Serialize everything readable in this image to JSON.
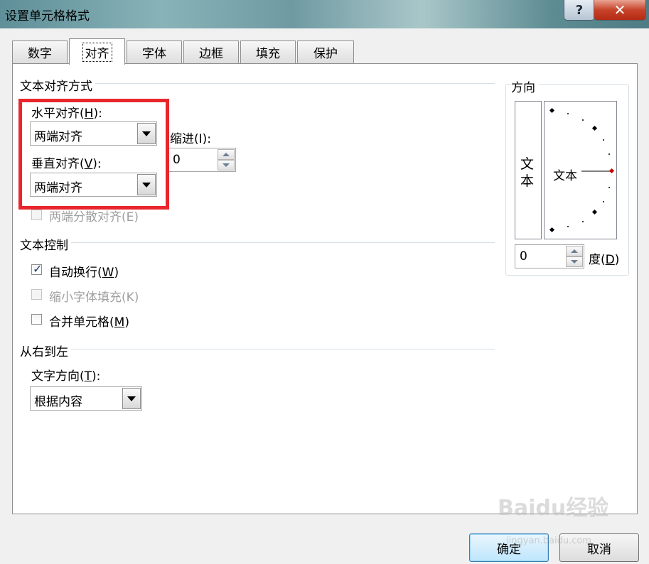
{
  "window": {
    "title": "设置单元格格式",
    "help_label": "?",
    "close_label": "✕"
  },
  "tabs": [
    {
      "label": "数字"
    },
    {
      "label": "对齐",
      "active": true
    },
    {
      "label": "字体"
    },
    {
      "label": "边框"
    },
    {
      "label": "填充"
    },
    {
      "label": "保护"
    }
  ],
  "text_alignment": {
    "title": "文本对齐方式",
    "horizontal_label": "水平对齐(",
    "horizontal_key": "H",
    "horizontal_suffix": "):",
    "horizontal_value": "两端对齐",
    "indent_label": "缩进(I):",
    "indent_value": "0",
    "vertical_label": "垂直对齐(",
    "vertical_key": "V",
    "vertical_suffix": "):",
    "vertical_value": "两端对齐",
    "justify_distributed_label": "两端分散对齐(E)"
  },
  "text_control": {
    "title": "文本控制",
    "wrap_label": "自动换行(",
    "wrap_key": "W",
    "wrap_suffix": ")",
    "wrap_checked": true,
    "shrink_label": "缩小字体填充(K)",
    "merge_label": "合并单元格(",
    "merge_key": "M",
    "merge_suffix": ")"
  },
  "rtl": {
    "title": "从右到左",
    "direction_label": "文字方向(",
    "direction_key": "T",
    "direction_suffix": "):",
    "direction_value": "根据内容"
  },
  "orientation": {
    "title": "方向",
    "vertical_text": "文本",
    "arc_text": "文本",
    "degrees_value": "0",
    "degrees_label": "度(",
    "degrees_key": "D",
    "degrees_suffix": ")"
  },
  "buttons": {
    "ok": "确定",
    "cancel": "取消"
  },
  "watermark": {
    "logo": "Baidu经验",
    "url": "jingyan.baidu.com"
  },
  "colors": {
    "highlight": "#e8262c",
    "arc_marker": "#cc0000"
  }
}
